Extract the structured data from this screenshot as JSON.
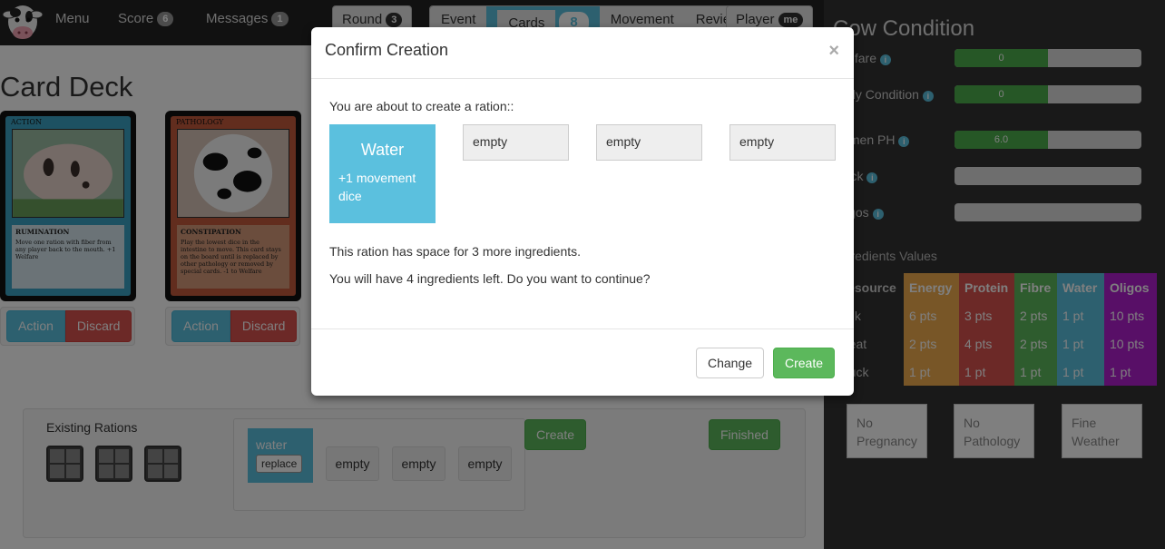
{
  "nav": {
    "menu": "Menu",
    "score": "Score",
    "score_count": "6",
    "messages": "Messages",
    "messages_count": "1",
    "round": "Round",
    "round_count": "3",
    "tabs": [
      {
        "label": "Event",
        "count": ""
      },
      {
        "label": "Cards",
        "count": "8"
      },
      {
        "label": "Movement",
        "count": ""
      },
      {
        "label": "Review",
        "count": ""
      }
    ],
    "player": "Player",
    "player_badge": "me"
  },
  "main": {
    "title": "Card Deck",
    "cards": [
      {
        "type": "ACTION",
        "name": "RUMINATION",
        "text": "Move one ration with fiber from any player back to the mouth. +1 Welfare",
        "action": "Action",
        "discard": "Discard"
      },
      {
        "type": "PATHOLOGY",
        "name": "CONSTIPATION",
        "text": "Play the lowest dice in the intestine to move. This card stays on the board until is replaced by other pathology or removed by special cards. -1 to Welfare",
        "action": "Action",
        "discard": "Discard"
      }
    ],
    "rations": {
      "label": "Existing Rations",
      "water_label": "water",
      "replace": "replace",
      "slots": [
        "empty",
        "empty",
        "empty"
      ],
      "create": "Create",
      "finished": "Finished"
    }
  },
  "cow": {
    "title": "Cow Condition",
    "stats": [
      {
        "label": "Welfare",
        "value": "0",
        "fill": 0.5
      },
      {
        "label": "Body Condition",
        "value": "0",
        "fill": 0.5
      },
      {
        "label": "Rumen PH",
        "value": "6.0",
        "fill": 0.5
      },
      {
        "label": "Muck",
        "value": "",
        "fill": 0
      },
      {
        "label": "Oligos",
        "value": "",
        "fill": 0
      }
    ],
    "ingredients_title": "Ingredients Values",
    "table": {
      "headers": [
        "Resource",
        "Energy",
        "Protein",
        "Fibre",
        "Water",
        "Oligos"
      ],
      "rows": [
        [
          "Milk",
          "6 pts",
          "3 pts",
          "2 pts",
          "1 pt",
          "10 pts"
        ],
        [
          "Meat",
          "2 pts",
          "4 pts",
          "2 pts",
          "1 pt",
          "10 pts"
        ],
        [
          "Muck",
          "1 pt",
          "1 pt",
          "1 pt",
          "1 pt",
          "1 pt"
        ]
      ]
    },
    "conditions": [
      "No Pregnancy",
      "No Pathology",
      "Fine Weather"
    ]
  },
  "modal": {
    "title": "Confirm Creation",
    "close": "×",
    "intro": "You are about to create a ration::",
    "ingredient_name": "Water",
    "ingredient_effect": "+1 movement dice",
    "slots": [
      "empty",
      "empty",
      "empty"
    ],
    "space_text": "This ration has space for 3 more ingredients.",
    "left_text": "You will have 4 ingredients left. Do you want to continue?",
    "change": "Change",
    "create": "Create"
  },
  "colors": {
    "info": "#5bc0de",
    "danger": "#d9534f",
    "success": "#5cb85c",
    "warning": "#f0ad4e",
    "oligos": "#b01fcf",
    "navbar": "#222222",
    "panel": "#333333"
  }
}
